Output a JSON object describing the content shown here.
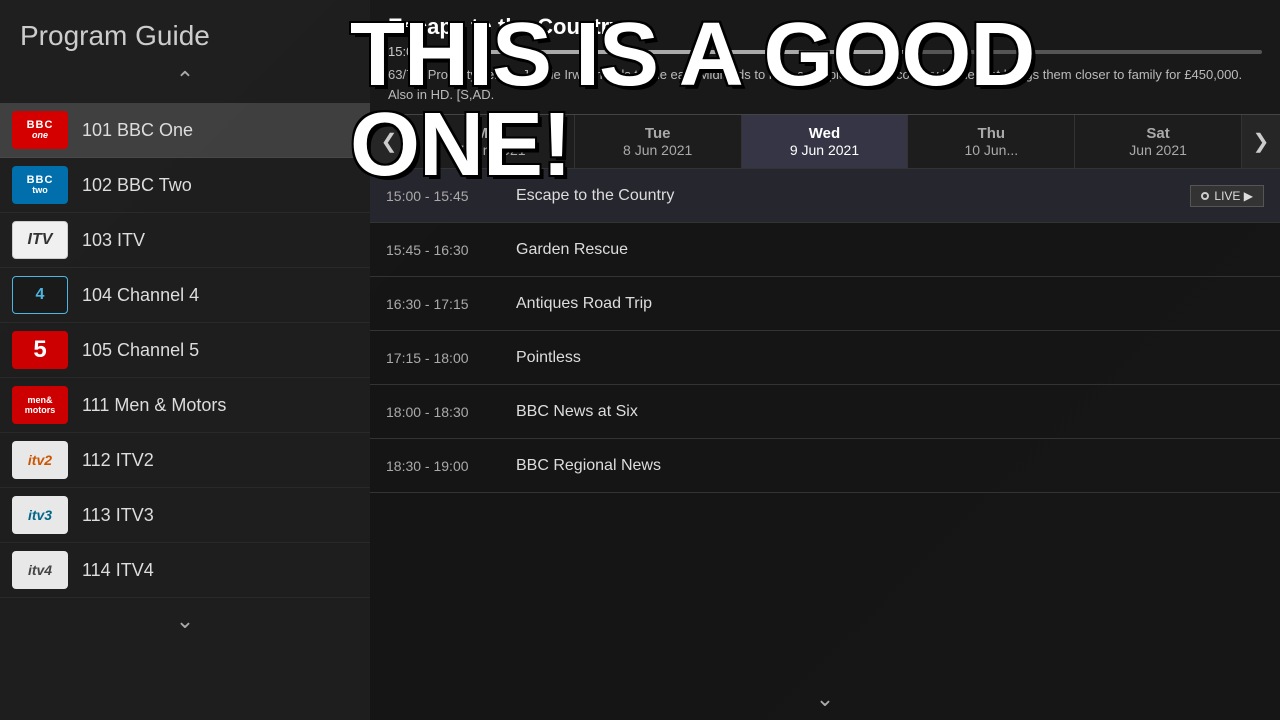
{
  "app": {
    "title": "Program Guide"
  },
  "headline": "THIS IS A GOOD ONE!",
  "channels": [
    {
      "id": "101",
      "name": "101 BBC One",
      "logo_type": "bbc1",
      "active": true
    },
    {
      "id": "102",
      "name": "102 BBC Two",
      "logo_type": "bbc2",
      "active": false
    },
    {
      "id": "103",
      "name": "103 ITV",
      "logo_type": "itv",
      "active": false
    },
    {
      "id": "104",
      "name": "104 Channel 4",
      "logo_type": "ch4",
      "active": false
    },
    {
      "id": "105",
      "name": "105 Channel 5",
      "logo_type": "ch5",
      "active": false
    },
    {
      "id": "111",
      "name": "111 Men & Motors",
      "logo_type": "men",
      "active": false
    },
    {
      "id": "112",
      "name": "112 ITV2",
      "logo_type": "itv2",
      "active": false
    },
    {
      "id": "113",
      "name": "113 ITV3",
      "logo_type": "itv3",
      "active": false
    },
    {
      "id": "114",
      "name": "114 ITV4",
      "logo_type": "itv4",
      "active": false
    }
  ],
  "program_detail": {
    "title": "Escape to the Country",
    "time": "15:00 - 15:45",
    "progress_percent": 55,
    "description": "63/70. Property series. Jonnie Irwin heads to the east Midlands to help a couple find the country home that brings them closer to family for £450,000. Also in HD. [S,AD."
  },
  "date_tabs": [
    {
      "day": "Mon",
      "date": "7 Jun 2021",
      "active": false
    },
    {
      "day": "Tue",
      "date": "8 Jun 2021",
      "active": false
    },
    {
      "day": "Wed",
      "date": "9 Jun 2021",
      "active": true
    },
    {
      "day": "Thu",
      "date": "10 Jun...",
      "active": false
    },
    {
      "day": "Sat",
      "date": "Jun 2021",
      "active": false
    }
  ],
  "programs": [
    {
      "time": "15:00 - 15:45",
      "title": "Escape to the Country",
      "is_current": true,
      "live": true
    },
    {
      "time": "15:45 - 16:30",
      "title": "Garden Rescue",
      "is_current": false,
      "live": false
    },
    {
      "time": "16:30 - 17:15",
      "title": "Antiques Road Trip",
      "is_current": false,
      "live": false
    },
    {
      "time": "17:15 - 18:00",
      "title": "Pointless",
      "is_current": false,
      "live": false
    },
    {
      "time": "18:00 - 18:30",
      "title": "BBC News at Six",
      "is_current": false,
      "live": false
    },
    {
      "time": "18:30 - 19:00",
      "title": "BBC Regional News",
      "is_current": false,
      "live": false
    }
  ],
  "nav": {
    "prev_arrow": "❮",
    "next_arrow": "❯",
    "chevron_up": "^",
    "chevron_down": "v",
    "live_label": "LIVE"
  }
}
